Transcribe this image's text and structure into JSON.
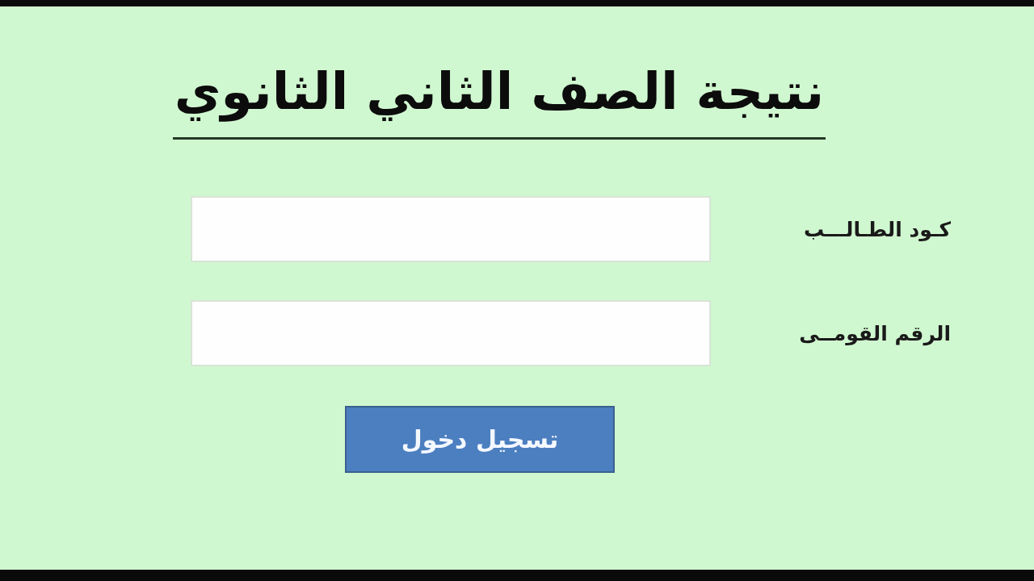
{
  "page": {
    "title": "نتيجة الصف الثاني الثانوي"
  },
  "fields": [
    {
      "label": "كـود الطـالـــب"
    },
    {
      "label": "الرقم القومــى"
    }
  ],
  "submit_button": {
    "label": "تسجيل دخول"
  }
}
